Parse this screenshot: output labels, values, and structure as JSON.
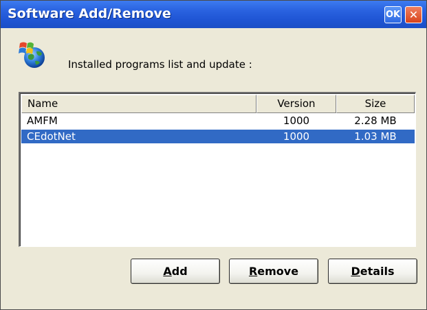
{
  "window": {
    "title": "Software Add/Remove",
    "ok_label": "OK",
    "close_label": "✕"
  },
  "header": {
    "icon": "windows-flag-globe-icon",
    "text": "Installed programs list and update :"
  },
  "list": {
    "columns": [
      "Name",
      "Version",
      "Size"
    ],
    "rows": [
      {
        "name": "AMFM",
        "version": "1000",
        "size": "2.28 MB",
        "selected": false
      },
      {
        "name": "CEdotNet",
        "version": "1000",
        "size": "1.03 MB",
        "selected": true
      }
    ]
  },
  "buttons": {
    "add": {
      "accel": "A",
      "rest": "dd"
    },
    "remove": {
      "accel": "R",
      "rest": "emove"
    },
    "details": {
      "accel": "D",
      "rest": "etails"
    }
  },
  "colors": {
    "titlebar": "#2a63e0",
    "selection": "#316ac5",
    "window_bg": "#ece9d8"
  }
}
